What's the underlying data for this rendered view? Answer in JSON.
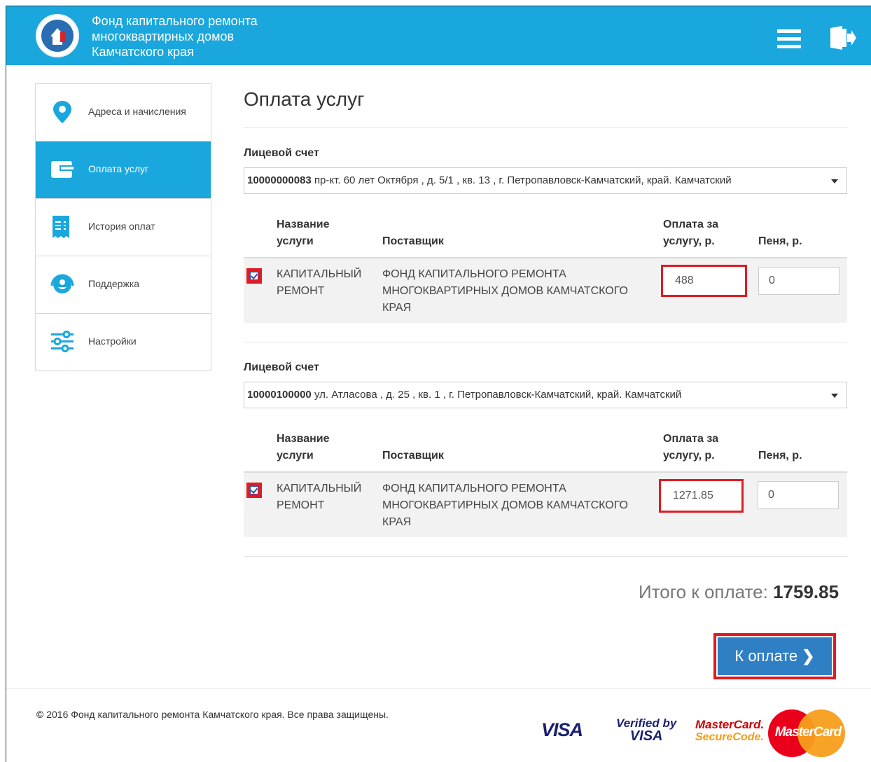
{
  "header": {
    "title_lines": [
      "Фонд капитального ремонта",
      "многоквартирных домов",
      "Камчатского края"
    ],
    "menu_icon": "hamburger-icon",
    "logout_icon": "logout-icon",
    "color": "#1aa7dd"
  },
  "sidebar": {
    "items": [
      {
        "label": "Адреса и начисления",
        "icon": "map-pin-icon",
        "active": false
      },
      {
        "label": "Оплата услуг",
        "icon": "wallet-icon",
        "active": true
      },
      {
        "label": "История оплат",
        "icon": "receipt-icon",
        "active": false
      },
      {
        "label": "Поддержка",
        "icon": "support-icon",
        "active": false
      },
      {
        "label": "Настройки",
        "icon": "sliders-icon",
        "active": false
      }
    ]
  },
  "main": {
    "title": "Оплата услуг",
    "accounts": [
      {
        "label": "Лицевой счет",
        "number": "10000000083",
        "address": "пр-кт. 60 лет Октября , д. 5/1 , кв. 13 , г. Петропавловск-Камчатский, край. Камчатский",
        "headers": {
          "service": "Название услуги",
          "provider": "Поставщик",
          "amount": "Оплата за услугу, р.",
          "fine": "Пеня, р."
        },
        "row": {
          "checked": true,
          "service": "КАПИТАЛЬНЫЙ РЕМОНТ",
          "provider": "ФОНД КАПИТАЛЬНОГО РЕМОНТА МНОГОКВАРТИРНЫХ ДОМОВ КАМЧАТСКОГО КРАЯ",
          "amount": "488",
          "fine": "0"
        }
      },
      {
        "label": "Лицевой счет",
        "number": "10000100000",
        "address": "ул. Атласова , д. 25 , кв. 1 , г. Петропавловск-Камчатский, край. Камчатский",
        "headers": {
          "service": "Название услуги",
          "provider": "Поставщик",
          "amount": "Оплата за услугу, р.",
          "fine": "Пеня, р."
        },
        "row": {
          "checked": true,
          "service": "КАПИТАЛЬНЫЙ РЕМОНТ",
          "provider": "ФОНД КАПИТАЛЬНОГО РЕМОНТА МНОГОКВАРТИРНЫХ ДОМОВ КАМЧАТСКОГО КРАЯ",
          "amount": "1271.85",
          "fine": "0"
        }
      }
    ],
    "total_label": "Итого к оплате:",
    "total_value": "1759.85",
    "pay_button": "К оплате"
  },
  "footer": {
    "copyright": "2016 Фонд капитального ремонта Камчатского края. Все права защищены.",
    "logos": {
      "visa": "VISA",
      "verified_top": "Verified by",
      "verified_bottom": "VISA",
      "mc_secure_top": "MasterCard.",
      "mc_secure_bottom": "SecureCode.",
      "mastercard": "MasterCard"
    },
    "accent_red": "#e11b22"
  }
}
